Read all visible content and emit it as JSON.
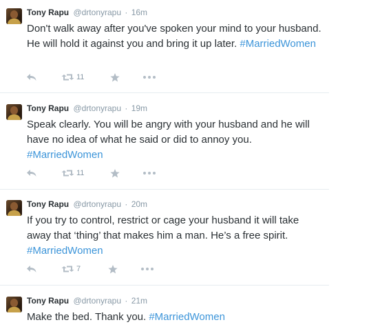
{
  "tweets": [
    {
      "fullname": "Tony Rapu",
      "screenname": "@drtonyrapu",
      "separator": "·",
      "time": "16m",
      "text": "Don't walk away after you've spoken your mind to your husband. He will hold it against you and bring it up later. ",
      "hashtag": "#MarriedWomen",
      "retweet_count": "11"
    },
    {
      "fullname": "Tony Rapu",
      "screenname": "@drtonyrapu",
      "separator": "·",
      "time": "19m",
      "text": "Speak clearly. You will be angry with your husband and he will have no idea of what he said or did to annoy you. ",
      "hashtag": "#MarriedWomen",
      "retweet_count": "11"
    },
    {
      "fullname": "Tony Rapu",
      "screenname": "@drtonyrapu",
      "separator": "·",
      "time": "20m",
      "text": "If you try to control, restrict or cage your husband it will take away that ‘thing’ that makes him a man. He’s a free spirit. ",
      "hashtag": "#MarriedWomen",
      "retweet_count": "7"
    },
    {
      "fullname": "Tony Rapu",
      "screenname": "@drtonyrapu",
      "separator": "·",
      "time": "21m",
      "text": "Make the bed. Thank you. ",
      "hashtag": "#MarriedWomen"
    }
  ],
  "icons": {
    "reply": "reply-icon",
    "retweet": "retweet-icon",
    "favorite": "star-icon",
    "more": "more-dots-icon"
  },
  "colors": {
    "text": "#292f33",
    "muted": "#8899a6",
    "hashtag": "#3b94d9",
    "icon": "#b3bdc6",
    "divider": "#e6ecf0"
  }
}
